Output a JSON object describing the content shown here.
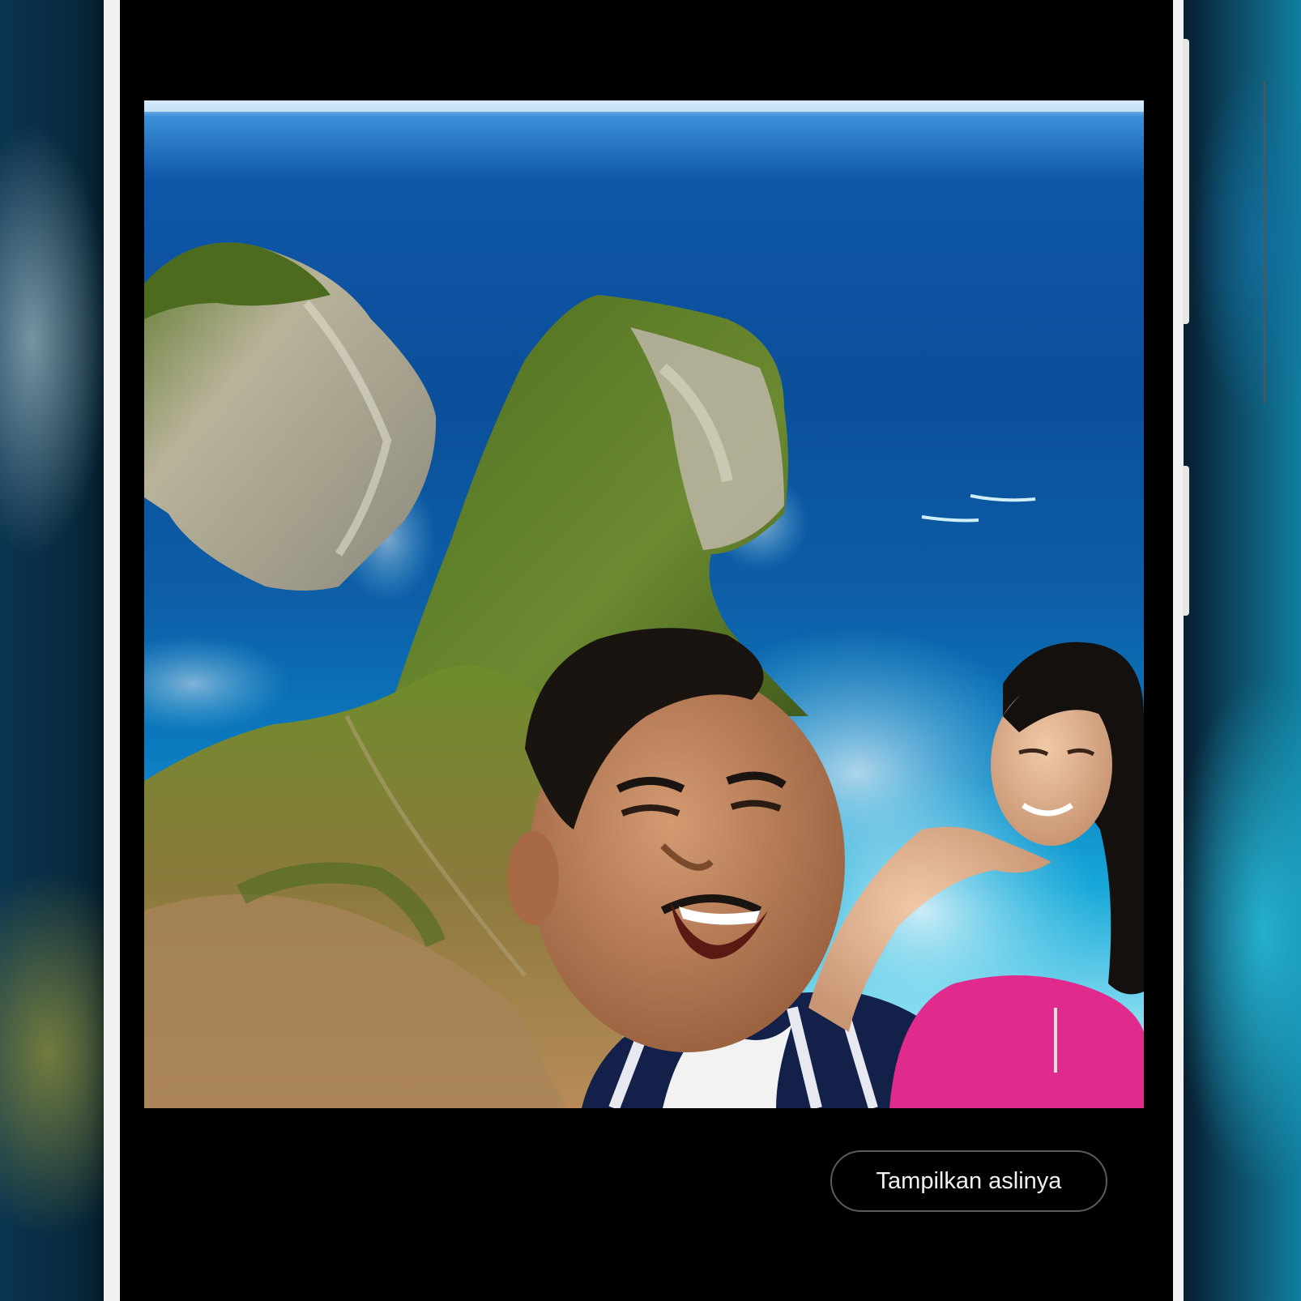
{
  "photo_viewer": {
    "image_name": "ai-edited-photo",
    "show_original_label": "Tampilkan aslinya"
  },
  "colors": {
    "screen_background": "#000000",
    "button_border": "#5c5c5c",
    "button_text": "#f2f2f2",
    "phone_frame": "#f1f1f1"
  }
}
